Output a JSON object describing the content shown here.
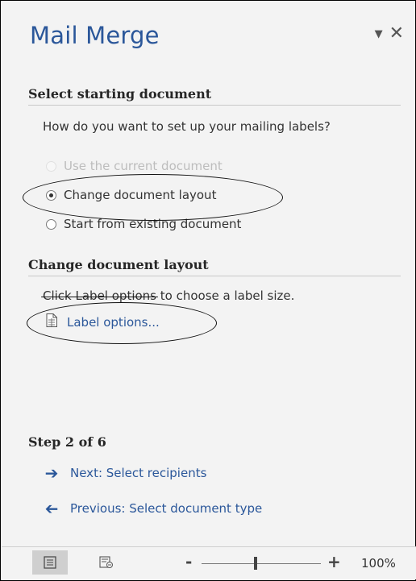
{
  "pane": {
    "title": "Mail Merge",
    "dropdown_icon": "chevron-down-icon",
    "close_icon": "close-icon"
  },
  "section1": {
    "heading": "Select starting document",
    "question": "How do you want to set up your mailing labels?",
    "options": [
      {
        "label": "Use the current document",
        "state": "disabled"
      },
      {
        "label": "Change document layout",
        "state": "selected"
      },
      {
        "label": "Start from existing document",
        "state": "unselected"
      }
    ]
  },
  "section2": {
    "heading": "Change document layout",
    "instruction_prefix": "Click Label options",
    "instruction_suffix": " to choose a label size.",
    "link_label": "Label options...",
    "link_icon": "document-icon"
  },
  "step": {
    "heading": "Step 2 of 6",
    "next_label": "Next: Select recipients",
    "previous_label": "Previous: Select document type"
  },
  "status_bar": {
    "view_icons": [
      "print-layout-icon",
      "web-layout-icon"
    ],
    "zoom_minus": "-",
    "zoom_plus": "+",
    "zoom_level": "100%",
    "zoom_fraction": 0.5
  },
  "colors": {
    "accent": "#2b579a",
    "pane_background": "#f3f3f3",
    "annotation": "#111111"
  }
}
